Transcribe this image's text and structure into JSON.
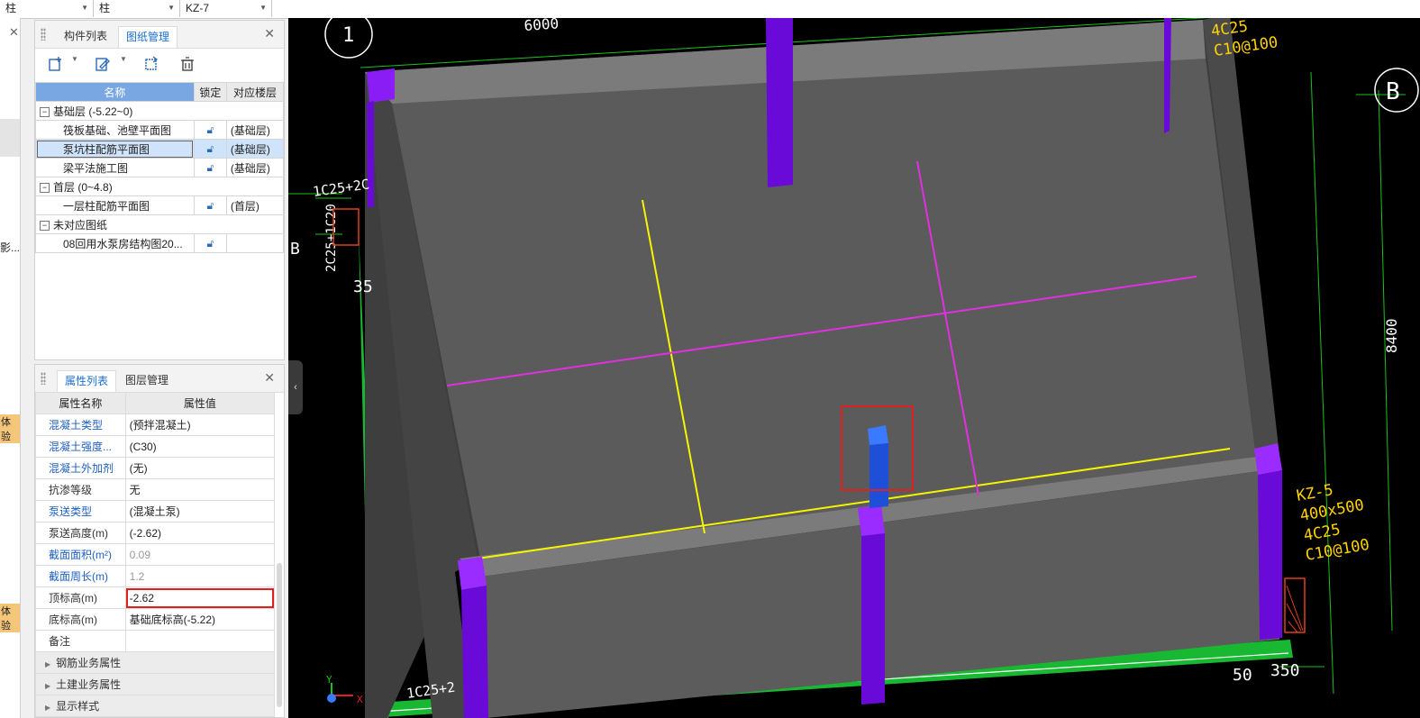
{
  "topbar": {
    "combo1": "柱",
    "combo2": "柱",
    "combo3": "KZ-7"
  },
  "left_strip": {
    "text1": "影...",
    "badge1": "体验",
    "badge2": "体验"
  },
  "drawing_panel": {
    "tabs": [
      "构件列表",
      "图纸管理"
    ],
    "active_tab": "图纸管理",
    "headers": [
      "名称",
      "锁定",
      "对应楼层"
    ],
    "groups": [
      {
        "label": "基础层 (-5.22~0)",
        "items": [
          {
            "name": "筏板基础、池壁平面图",
            "floor": "(基础层)"
          },
          {
            "name": "泵坑柱配筋平面图",
            "floor": "(基础层)"
          },
          {
            "name": "梁平法施工图",
            "floor": "(基础层)"
          }
        ]
      },
      {
        "label": "首层 (0~4.8)",
        "items": [
          {
            "name": "一层柱配筋平面图",
            "floor": "(首层)"
          }
        ]
      },
      {
        "label": "未对应图纸",
        "items": [
          {
            "name": "08回用水泵房结构图20...",
            "floor": ""
          }
        ]
      }
    ]
  },
  "property_panel": {
    "tabs": [
      "属性列表",
      "图层管理"
    ],
    "active_tab": "属性列表",
    "headers": [
      "属性名称",
      "属性值"
    ],
    "rows": [
      {
        "name": "混凝土类型",
        "value": "(预拌混凝土)",
        "blue": true
      },
      {
        "name": "混凝土强度...",
        "value": "(C30)",
        "blue": true
      },
      {
        "name": "混凝土外加剂",
        "value": "(无)",
        "blue": true
      },
      {
        "name": "抗渗等级",
        "value": "无",
        "blue": false
      },
      {
        "name": "泵送类型",
        "value": "(混凝土泵)",
        "blue": true
      },
      {
        "name": "泵送高度(m)",
        "value": "(-2.62)",
        "blue": false
      },
      {
        "name": "截面面积(m²)",
        "value": "0.09",
        "blue": true
      },
      {
        "name": "截面周长(m)",
        "value": "1.2",
        "blue": true
      },
      {
        "name": "顶标高(m)",
        "value": "-2.62",
        "blue": false
      },
      {
        "name": "底标高(m)",
        "value": "基础底标高(-5.22)",
        "blue": false
      },
      {
        "name": "备注",
        "value": "",
        "blue": false
      }
    ],
    "groups": [
      "钢筋业务属性",
      "土建业务属性",
      "显示样式"
    ]
  },
  "viewport": {
    "labels": {
      "axis_1": "1",
      "axis_b_right": "B",
      "axis_b_left": "B",
      "dim_top": "6000",
      "dim_right": "8400",
      "dim_50": "50",
      "dim_350": "350",
      "dim_35": "35",
      "rebar_top_right": [
        "4C25",
        "C10@100"
      ],
      "kz5": [
        "KZ-5",
        "400x500",
        "4C25",
        "C10@100"
      ],
      "rebar_left": "1C25+2C",
      "rebar_left_vert": "2C25+1C20",
      "rebar_bottom_left": "1C25+2",
      "axis_y": "Y",
      "axis_x": "X"
    }
  }
}
